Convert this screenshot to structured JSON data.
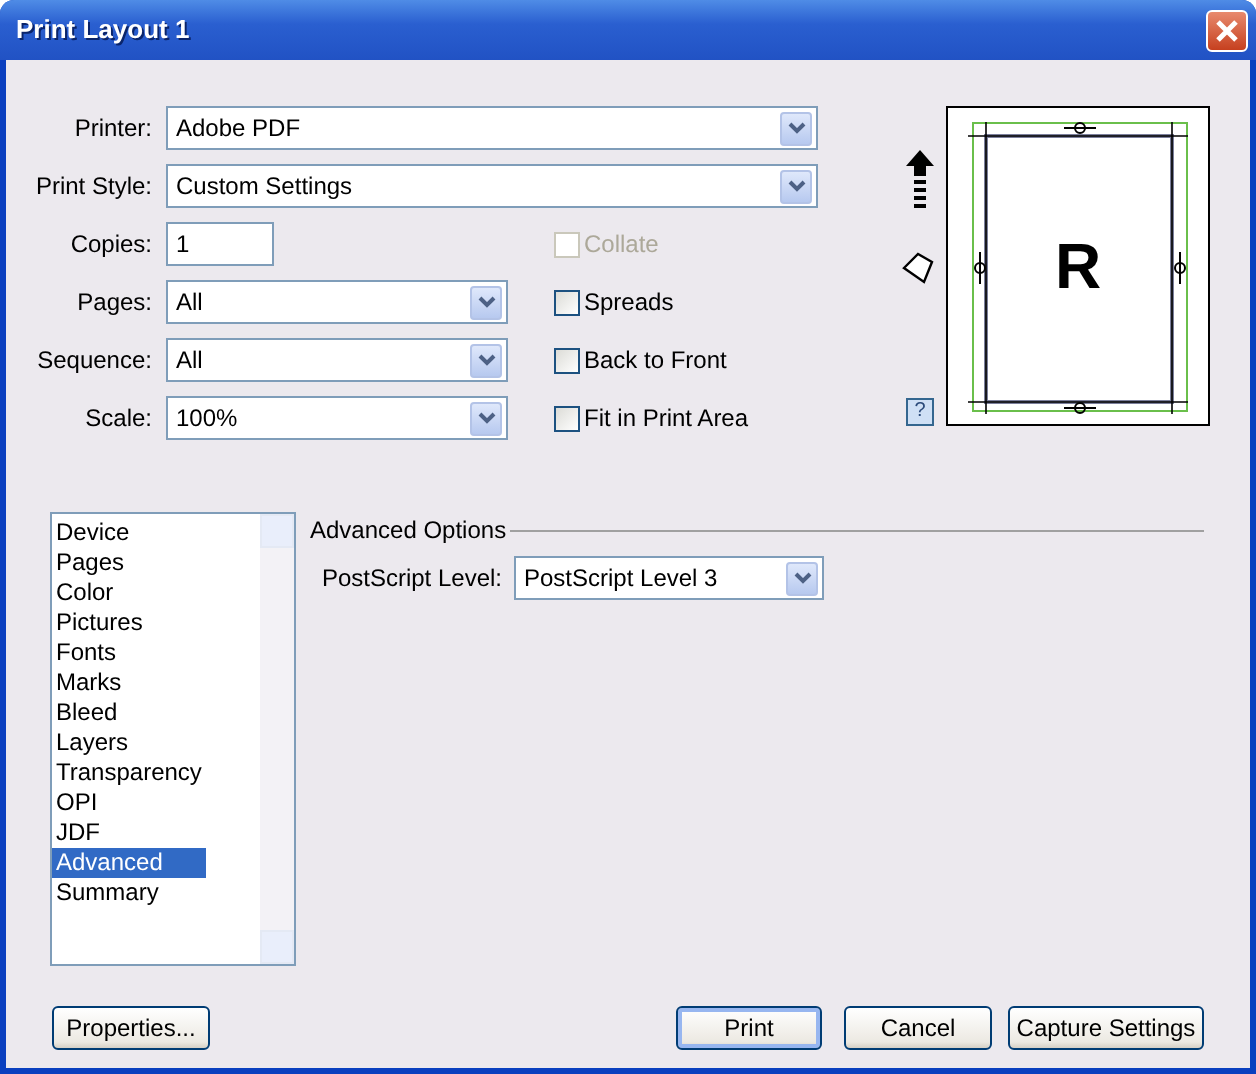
{
  "window": {
    "title": "Print Layout 1"
  },
  "fields": [
    {
      "label": "Printer:",
      "kind": "combo",
      "value": "Adobe PDF"
    },
    {
      "label": "Print Style:",
      "kind": "combo",
      "value": "Custom Settings"
    },
    {
      "label": "Copies:",
      "kind": "text",
      "value": "1"
    },
    {
      "label": "Pages:",
      "kind": "select",
      "value": "All"
    },
    {
      "label": "Sequence:",
      "kind": "select",
      "value": "All"
    },
    {
      "label": "Scale:",
      "kind": "select",
      "value": "100%"
    }
  ],
  "checkboxes": [
    {
      "label": "Collate",
      "checked": false,
      "disabled": true
    },
    {
      "label": "Spreads",
      "checked": false,
      "disabled": false
    },
    {
      "label": "Back to Front",
      "checked": false,
      "disabled": false
    },
    {
      "label": "Fit in Print Area",
      "checked": false,
      "disabled": false
    }
  ],
  "preview": {
    "letter": "R",
    "help": "?"
  },
  "categories": [
    {
      "label": "Device",
      "selected": false
    },
    {
      "label": "Pages",
      "selected": false
    },
    {
      "label": "Color",
      "selected": false
    },
    {
      "label": "Pictures",
      "selected": false
    },
    {
      "label": "Fonts",
      "selected": false
    },
    {
      "label": "Marks",
      "selected": false
    },
    {
      "label": "Bleed",
      "selected": false
    },
    {
      "label": "Layers",
      "selected": false
    },
    {
      "label": "Transparency",
      "selected": false
    },
    {
      "label": "OPI",
      "selected": false
    },
    {
      "label": "JDF",
      "selected": false
    },
    {
      "label": "Advanced",
      "selected": true
    },
    {
      "label": "Summary",
      "selected": false
    }
  ],
  "advanced": {
    "title": "Advanced Options",
    "label": "PostScript Level:",
    "value": "PostScript Level 3"
  },
  "buttons": [
    {
      "label": "Properties...",
      "default": false
    },
    {
      "label": "Print",
      "default": true
    },
    {
      "label": "Cancel",
      "default": false
    },
    {
      "label": "Capture Settings",
      "default": false
    }
  ]
}
